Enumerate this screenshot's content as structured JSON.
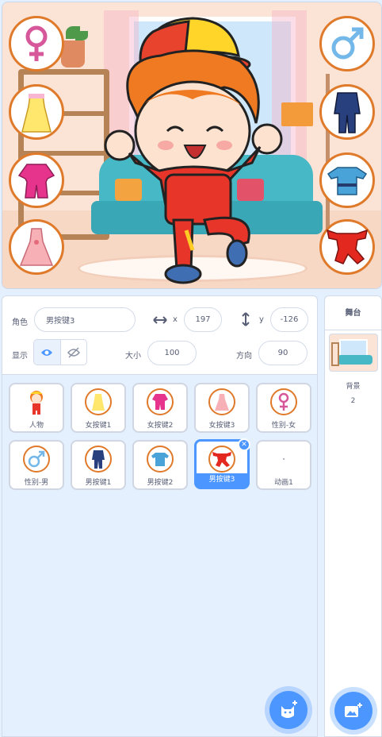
{
  "sprite_info": {
    "sprite_label": "角色",
    "sprite_name": "男按键3",
    "x_label": "x",
    "x_value": "197",
    "y_label": "y",
    "y_value": "-126",
    "show_label": "显示",
    "size_label": "大小",
    "size_value": "100",
    "direction_label": "方向",
    "direction_value": "90"
  },
  "sprites": [
    {
      "name": "人物",
      "icon": "boy-character-icon"
    },
    {
      "name": "女按键1",
      "icon": "yellow-dress-icon"
    },
    {
      "name": "女按键2",
      "icon": "pink-outfit-icon"
    },
    {
      "name": "女按键3",
      "icon": "pink-gown-icon"
    },
    {
      "name": "性别-女",
      "icon": "female-symbol-icon"
    },
    {
      "name": "性别-男",
      "icon": "male-symbol-icon"
    },
    {
      "name": "男按键1",
      "icon": "navy-suit-icon"
    },
    {
      "name": "男按键2",
      "icon": "blue-robe-icon"
    },
    {
      "name": "男按键3",
      "icon": "red-tracksuit-icon",
      "selected": true
    },
    {
      "name": "动画1",
      "icon": "blank-icon"
    }
  ],
  "stage_panel": {
    "title": "舞台",
    "backdrop_label": "背景",
    "backdrop_count": "2"
  },
  "colors": {
    "accent": "#4c97ff",
    "button_ring": "#e07a2b",
    "female": "#d6579a",
    "male": "#74b8ea"
  }
}
